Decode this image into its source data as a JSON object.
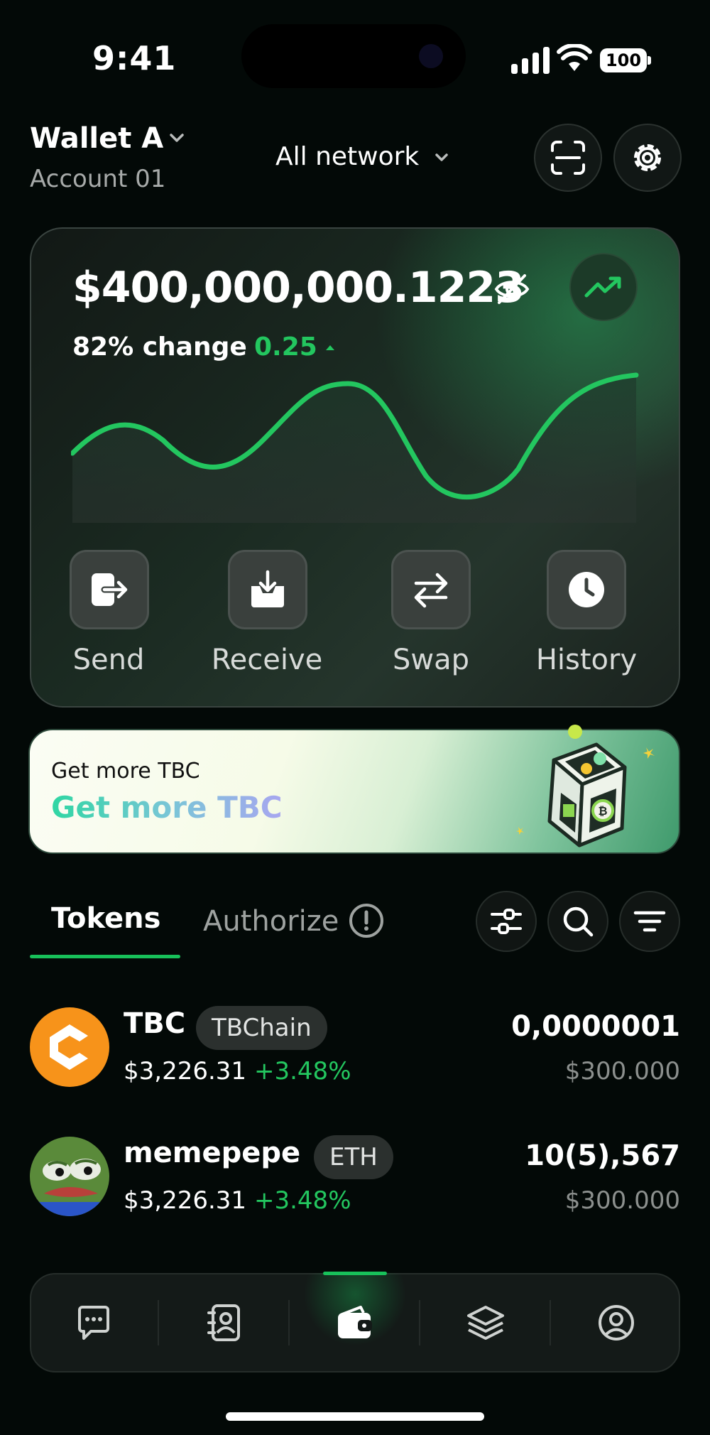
{
  "status_bar": {
    "time": "9:41",
    "battery": "100"
  },
  "header": {
    "wallet_name": "Wallet A",
    "account": "Account 01",
    "network": "All network"
  },
  "balance_card": {
    "balance": "$400,000,000.1223",
    "change_label": "82% change",
    "change_value": "0.25",
    "actions": [
      {
        "label": "Send",
        "icon": "send-icon"
      },
      {
        "label": "Receive",
        "icon": "receive-icon"
      },
      {
        "label": "Swap",
        "icon": "swap-icon"
      },
      {
        "label": "History",
        "icon": "history-icon"
      }
    ]
  },
  "promo": {
    "subtitle": "Get more TBC",
    "title": "Get more TBC"
  },
  "tabs": {
    "active": "Tokens",
    "inactive": "Authorize"
  },
  "tokens": [
    {
      "symbol": "TBC",
      "chain": "TBChain",
      "price": "$3,226.31",
      "change": "+3.48%",
      "amount": "0,0000001",
      "fiat": "$300.000"
    },
    {
      "symbol": "memepepe",
      "chain": "ETH",
      "price": "$3,226.31",
      "change": "+3.48%",
      "amount": "10(5),567",
      "fiat": "$300.000"
    }
  ],
  "bottom_nav": {
    "items": [
      "chat-icon",
      "contacts-icon",
      "wallet-icon",
      "layers-icon",
      "profile-icon"
    ],
    "active": "wallet-icon"
  },
  "colors": {
    "accent": "#23c65f",
    "background": "#030907",
    "card": "#1b2b22"
  }
}
